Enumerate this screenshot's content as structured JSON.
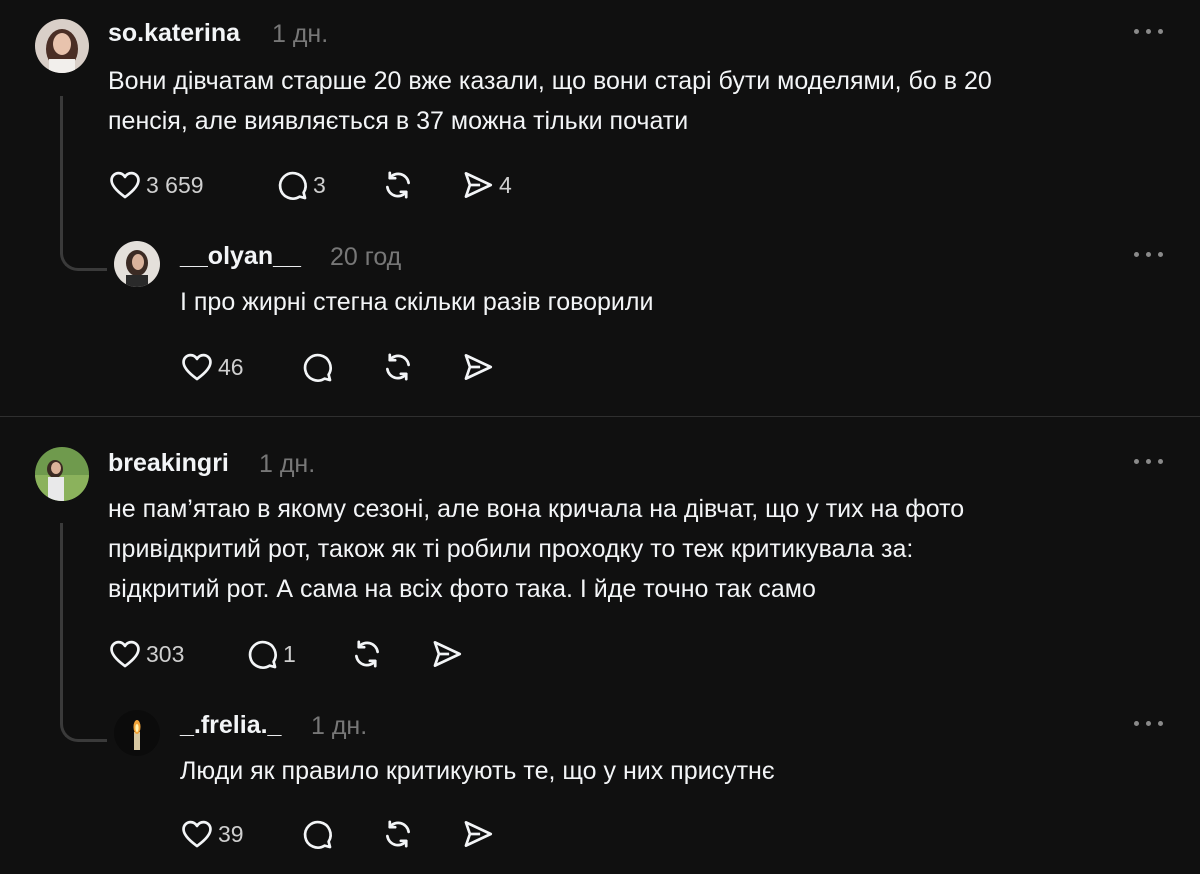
{
  "threads": [
    {
      "post": {
        "username": "so.katerina",
        "time": "1 дн.",
        "lines": [
          "Вони дівчатам старше 20 вже казали, що вони старі бути моделями, бо в 20",
          "пенсія, але виявляється в 37 можна тільки почати"
        ],
        "likes": "3 659",
        "replies": "3",
        "shares": "4"
      },
      "reply": {
        "username": "__olyan__",
        "time": "20 год",
        "lines": [
          "І про жирні стегна скільки разів говорили"
        ],
        "likes": "46"
      }
    },
    {
      "post": {
        "username": "breakingri",
        "time": "1 дн.",
        "lines": [
          "не пам’ятаю в якому сезоні, але вона кричала на дівчат, що у тих на фото",
          "привідкритий рот, також як ті робили проходку то теж критикувала за:",
          "відкритий рот. А сама на всіх фото така. І йде точно так само"
        ],
        "likes": "303",
        "replies": "1"
      },
      "reply": {
        "username": "_.frelia._",
        "time": "1 дн.",
        "lines": [
          "Люди як правило критикують те, що у них присутнє"
        ],
        "likes": "39"
      }
    }
  ],
  "icons": {
    "like": "heart-icon",
    "reply": "comment-icon",
    "repost": "repost-icon",
    "share": "send-icon",
    "more": "more-options-icon"
  },
  "colors": {
    "background": "#101010",
    "text": "#f3f5f7",
    "muted": "#777777"
  }
}
